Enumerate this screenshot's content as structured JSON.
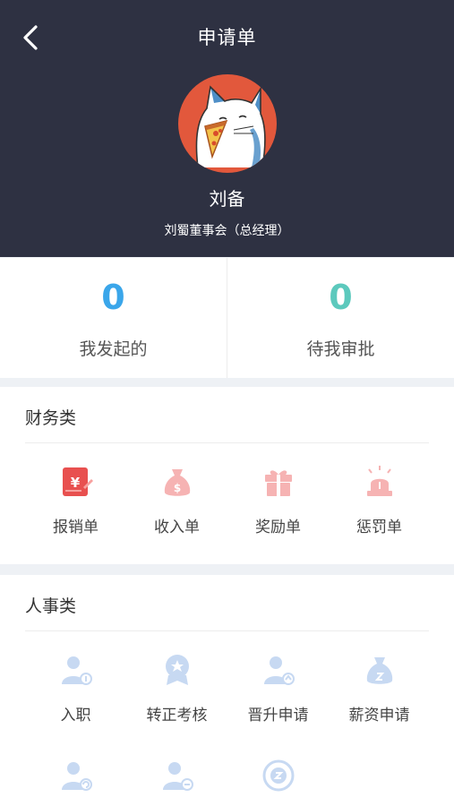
{
  "header": {
    "title": "申请单",
    "back_icon": "chevron-left-icon",
    "background": "#2e3142"
  },
  "profile": {
    "name": "刘备",
    "department": "刘蜀董事会（总经理）",
    "avatar": "cat-eating-pizza-avatar",
    "avatar_bg": "#e2583c"
  },
  "stats": [
    {
      "count": "0",
      "label": "我发起的",
      "color": "#3aa6ea"
    },
    {
      "count": "0",
      "label": "待我审批",
      "color": "#5cc9bd"
    }
  ],
  "finance": {
    "title": "财务类",
    "items": [
      {
        "label": "报销单",
        "icon": "expense-receipt-icon"
      },
      {
        "label": "收入单",
        "icon": "money-bag-icon"
      },
      {
        "label": "奖励单",
        "icon": "gift-icon"
      },
      {
        "label": "惩罚单",
        "icon": "siren-icon"
      }
    ]
  },
  "hr": {
    "title": "人事类",
    "items": [
      {
        "label": "入职",
        "icon": "onboard-user-icon"
      },
      {
        "label": "转正考核",
        "icon": "medal-icon"
      },
      {
        "label": "晋升申请",
        "icon": "promotion-user-icon"
      },
      {
        "label": "薪资申请",
        "icon": "salary-bag-icon"
      }
    ],
    "more_icons": [
      "user-transfer-icon",
      "user-leave-icon",
      "refresh-coin-icon"
    ]
  }
}
